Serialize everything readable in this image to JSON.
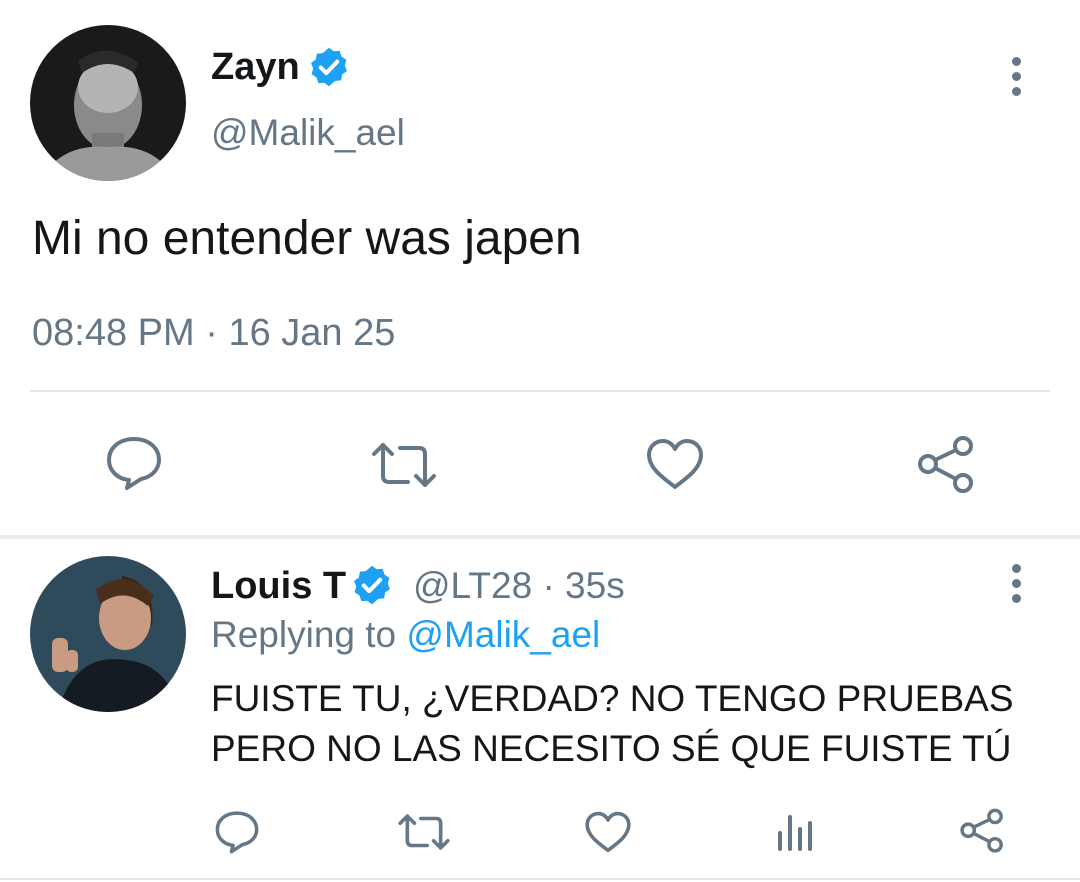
{
  "main_tweet": {
    "display_name": "Zayn",
    "handle": "@Malik_ael",
    "text": "Mi no entender was japen",
    "time": "08:48 PM",
    "date": "16 Jan 25",
    "separator": "·"
  },
  "actions_main": [
    "reply-icon",
    "retweet-icon",
    "like-icon",
    "share-icon"
  ],
  "reply_tweet": {
    "display_name": "Louis T",
    "handle": "@LT28",
    "separator": "·",
    "age": "35s",
    "replying_label": "Replying to",
    "replying_to": "@Malik_ael",
    "text_line1": "FUISTE TU, ¿VERDAD? NO TENGO PRUEBAS",
    "text_line2": "PERO NO LAS NECESITO SÉ QUE FUISTE TÚ"
  },
  "actions_reply": [
    "reply-icon",
    "retweet-icon",
    "like-icon",
    "analytics-icon",
    "share-icon"
  ],
  "colors": {
    "verified": "#1da1f2",
    "link": "#1da1f2",
    "secondary_text": "#657786",
    "divider": "#e1e8ed"
  }
}
